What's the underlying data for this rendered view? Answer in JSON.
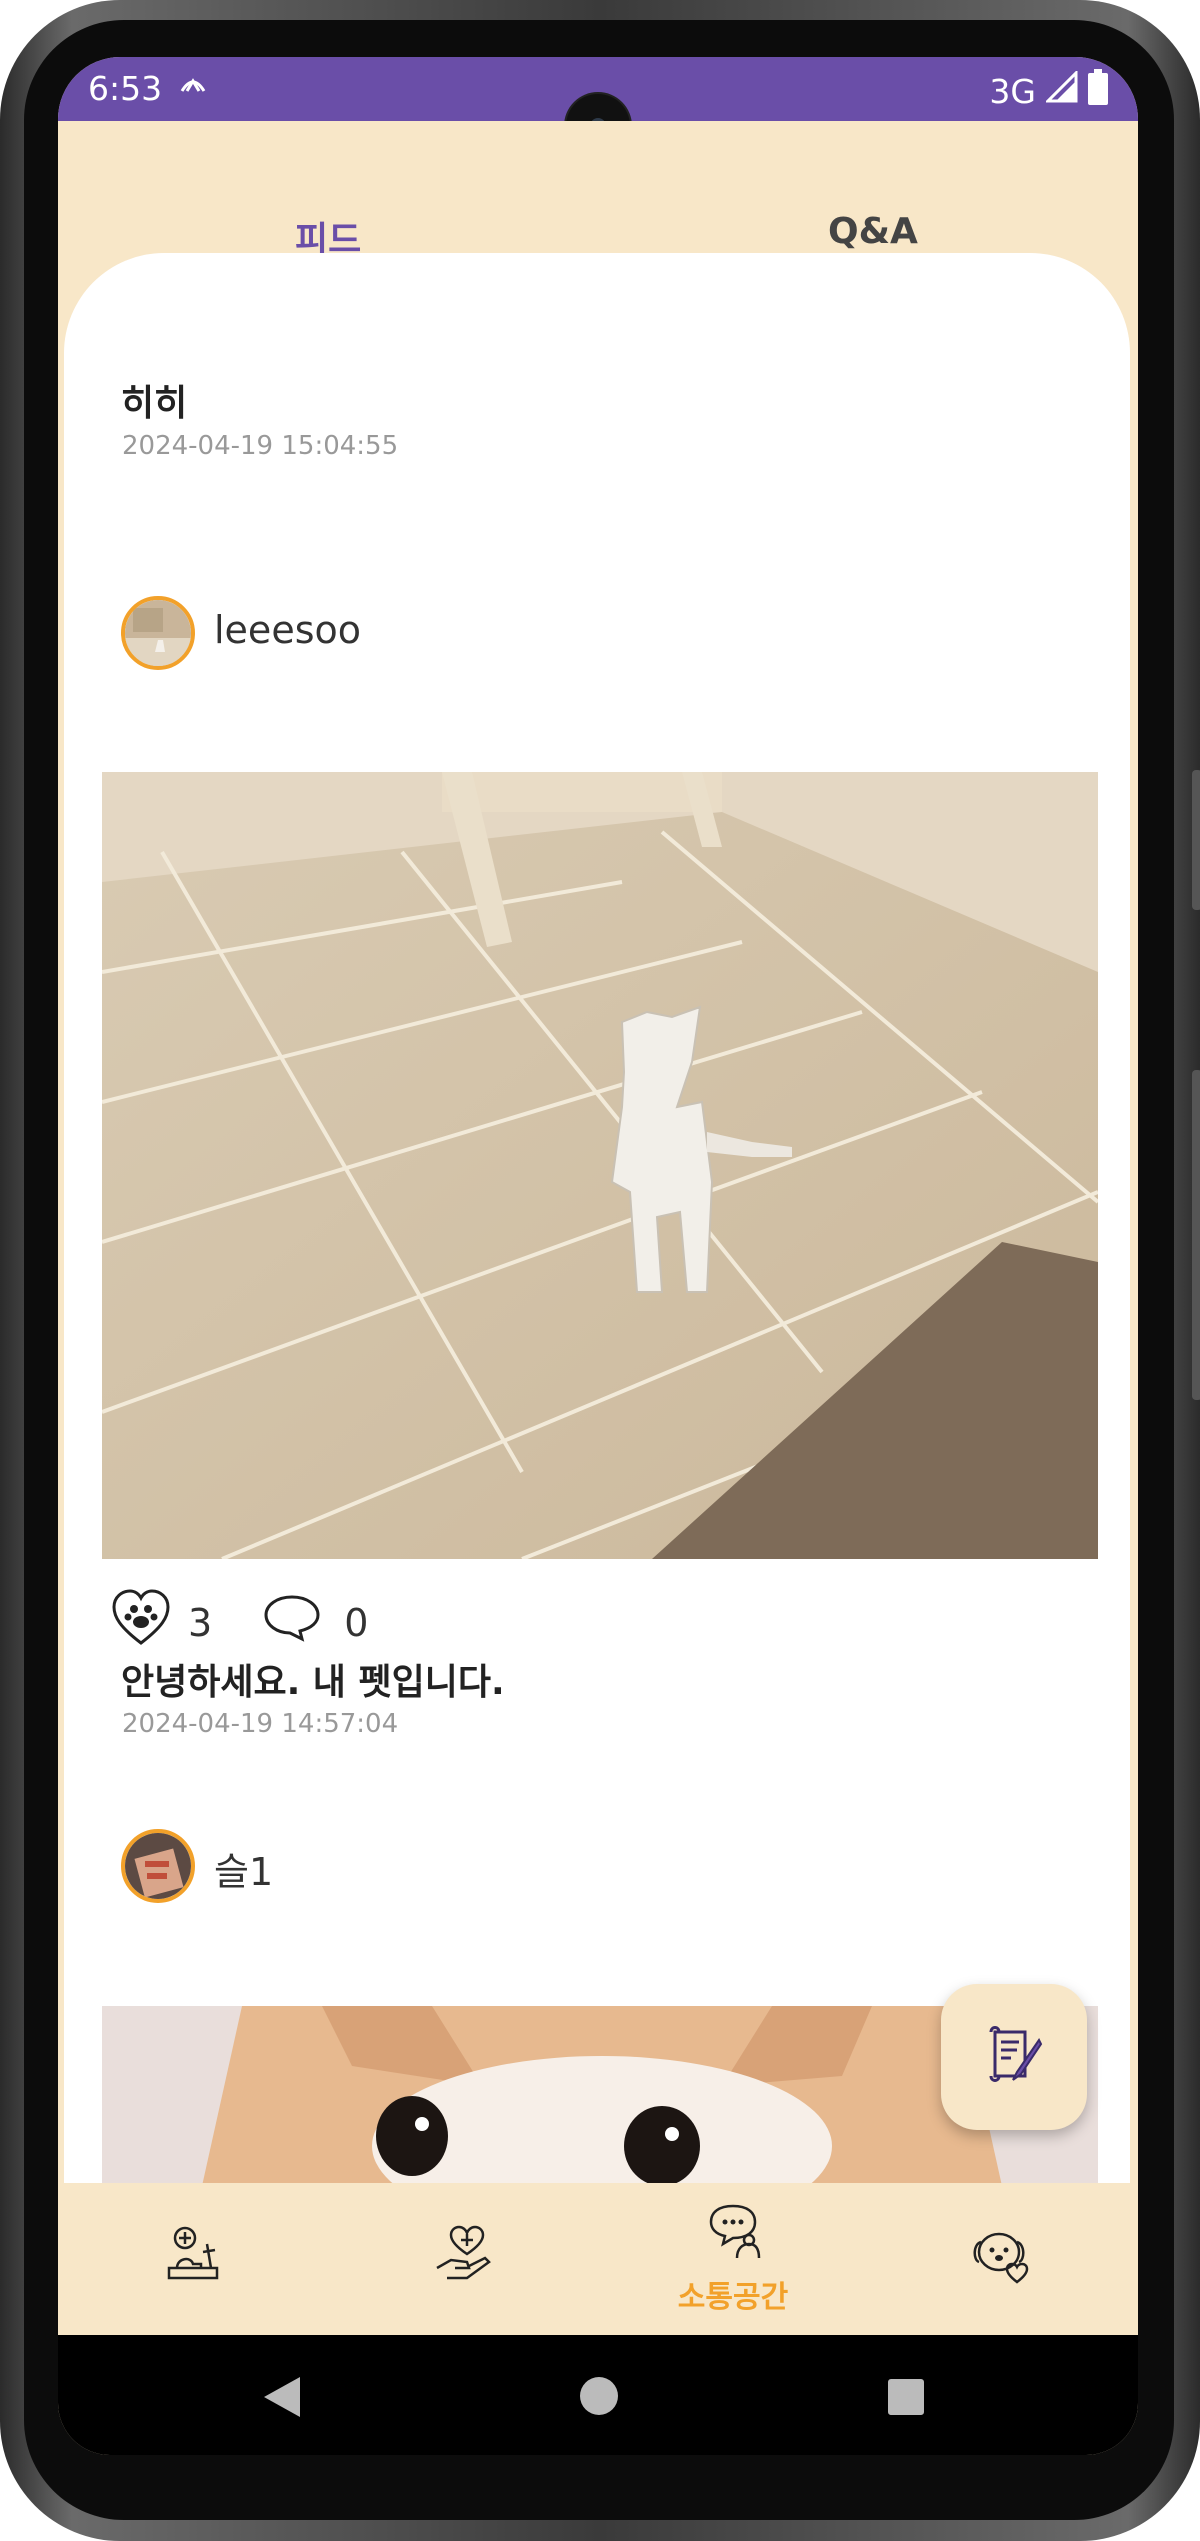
{
  "status_bar": {
    "time": "6:53",
    "network": "3G"
  },
  "tabs": [
    {
      "label": "피드"
    },
    {
      "label": "Q&A"
    }
  ],
  "posts": [
    {
      "text": "히히",
      "date": "2024-04-19 15:04:55"
    },
    {
      "username": "leeesoo",
      "likes": "3",
      "comments": "0",
      "text": "안녕하세요. 내 펫입니다.",
      "date": "2024-04-19 14:57:04"
    },
    {
      "username": "슬1"
    }
  ],
  "bottom_nav": [
    {
      "icon": "vet-clinic-icon",
      "label": ""
    },
    {
      "icon": "heart-hand-icon",
      "label": ""
    },
    {
      "icon": "chat-person-icon",
      "label": "소통공간"
    },
    {
      "icon": "dog-heart-icon",
      "label": ""
    }
  ],
  "colors": {
    "accent": "#6a4ea8",
    "background": "#f8e7c8",
    "highlight": "#f2a12a"
  }
}
